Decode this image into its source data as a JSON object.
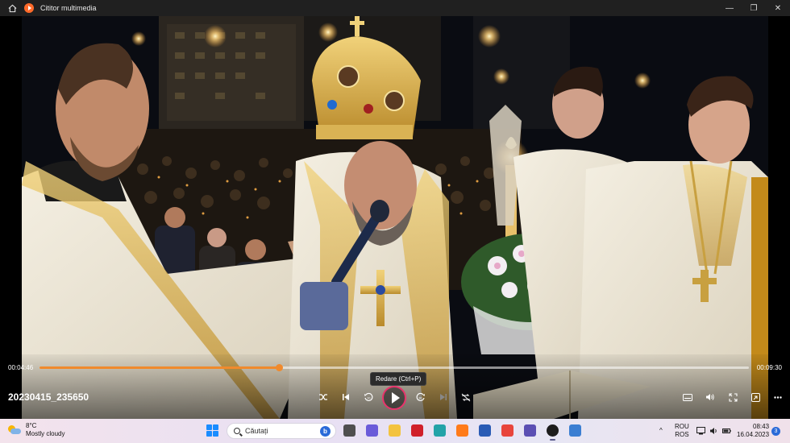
{
  "window": {
    "title": "Cititor multimedia",
    "home_icon": "home-icon",
    "minimize_symbol": "—",
    "maximize_symbol": "❐",
    "close_symbol": "✕"
  },
  "player": {
    "current_time": "00:04:46",
    "total_time": "00:09:30",
    "progress": 0.337,
    "file_name": "20230415_235650",
    "tooltip": "Redare (Ctrl+P)",
    "accent_color": "#f08a2c",
    "controls": {
      "shuffle": "shuffle-icon",
      "previous": "previous-icon",
      "rewind": "rewind-10-icon",
      "play": "play-icon",
      "forward": "forward-30-icon",
      "next": "next-icon",
      "repeat": "repeat-off-icon",
      "subtitles": "subtitles-icon",
      "volume": "volume-icon",
      "fullscreen": "fullscreen-icon",
      "miniplayer": "miniplayer-icon",
      "more": "more-icon"
    }
  },
  "taskbar": {
    "weather_temp": "8°C",
    "weather_desc": "Mostly cloudy",
    "search_placeholder": "Căutați",
    "search_badge": "b",
    "lang_top": "ROU",
    "lang_bottom": "ROS",
    "time": "08:43",
    "date": "16.04.2023",
    "notification_count": "3",
    "chevron": "^",
    "apps": [
      {
        "name": "widgets-app",
        "color": "#4f4f4f"
      },
      {
        "name": "chat-app",
        "color": "#6a5bd9"
      },
      {
        "name": "file-explorer-app",
        "color": "#f3c33f"
      },
      {
        "name": "antivirus-app",
        "color": "#d0202a"
      },
      {
        "name": "edge-app",
        "color": "#23a3a8"
      },
      {
        "name": "firefox-app",
        "color": "#ff7b1a"
      },
      {
        "name": "word-app",
        "color": "#2a5bb5"
      },
      {
        "name": "chrome-app",
        "color": "#e8453c"
      },
      {
        "name": "save-app",
        "color": "#5b4fb3"
      },
      {
        "name": "media-player-app",
        "color": "#1d1d1d"
      },
      {
        "name": "browser-app",
        "color": "#3b7fd2"
      }
    ]
  }
}
